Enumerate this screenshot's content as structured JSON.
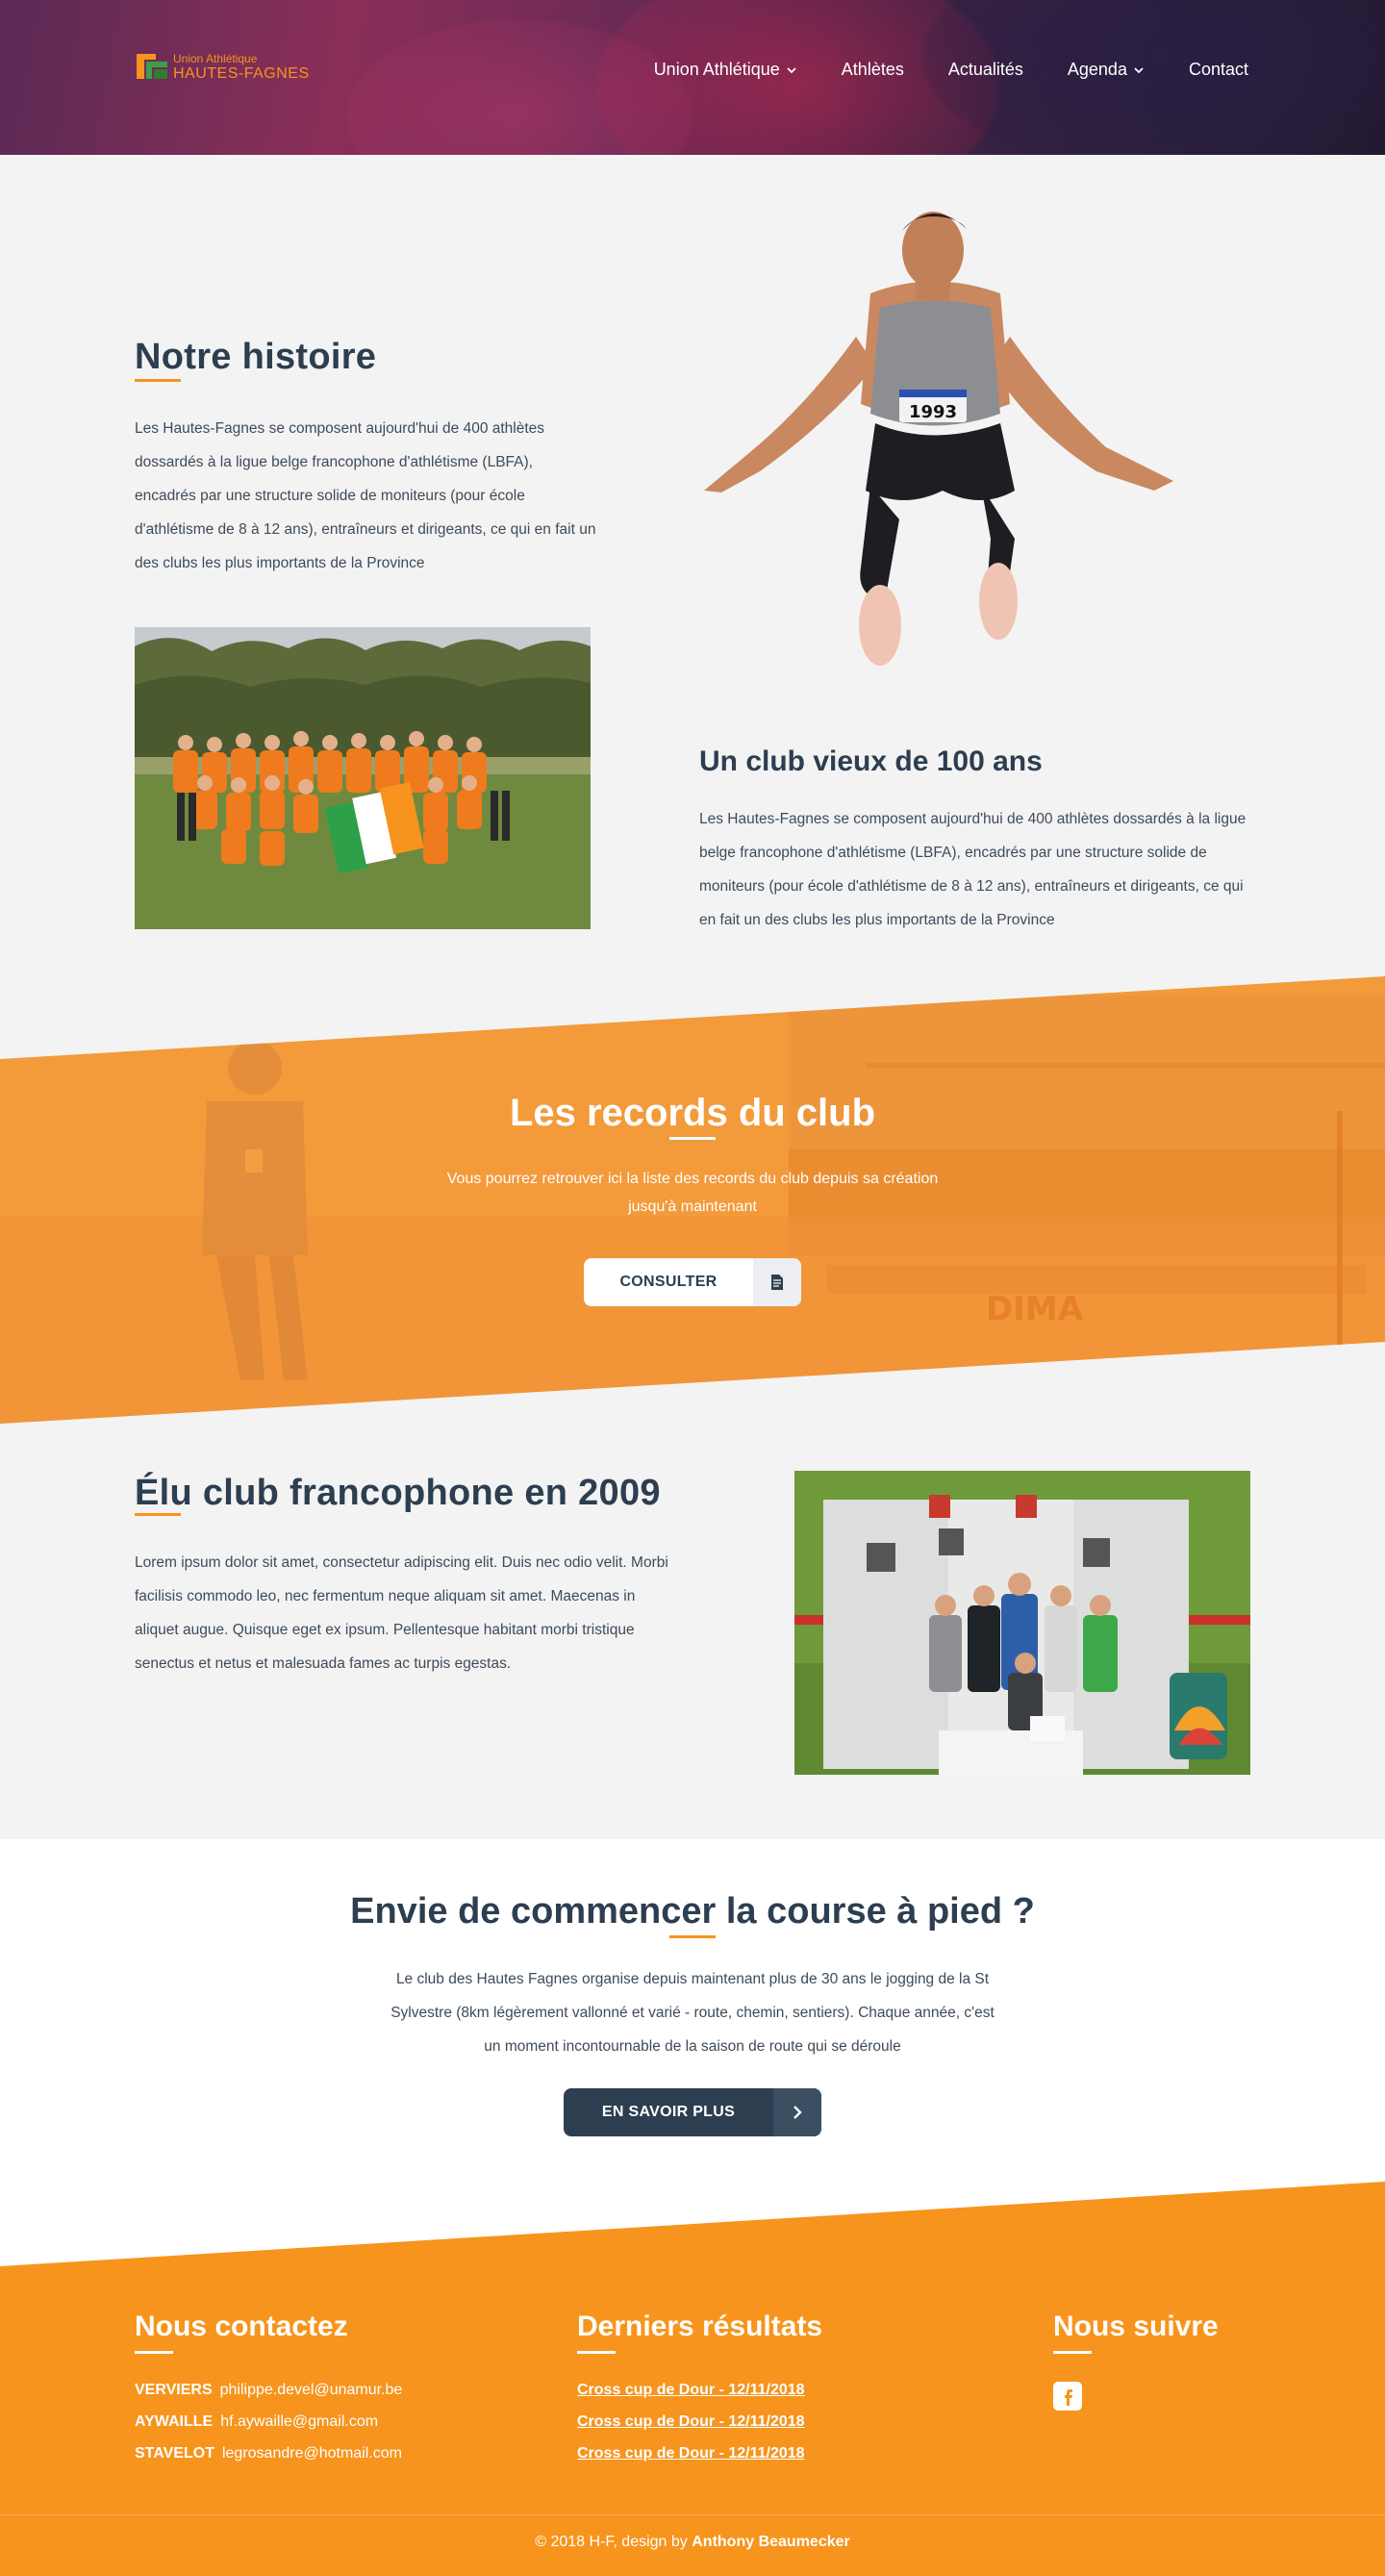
{
  "brand": {
    "logo_line1": "Union Athlétique",
    "logo_line2": "HAUTES-FAGNES",
    "accent": "#f7941d",
    "navy": "#2d3e50"
  },
  "nav": {
    "items": [
      {
        "label": "Union Athlétique",
        "dropdown": true
      },
      {
        "label": "Athlètes",
        "dropdown": false
      },
      {
        "label": "Actualités",
        "dropdown": false
      },
      {
        "label": "Agenda",
        "dropdown": true
      },
      {
        "label": "Contact",
        "dropdown": false
      }
    ]
  },
  "history": {
    "title": "Notre histoire",
    "text": "Les Hautes-Fagnes se composent aujourd'hui de 400 athlètes dossardés à la ligue belge francophone d'athlétisme (LBFA), encadrés par une structure solide de moniteurs (pour école d'athlétisme de 8 à 12 ans), entraîneurs et dirigeants, ce qui en fait un des clubs les plus importants de la Province",
    "athlete_bib": "1993"
  },
  "century": {
    "title": "Un club vieux de 100 ans",
    "text": "Les Hautes-Fagnes se composent aujourd'hui de 400 athlètes dossardés à la ligue belge francophone d'athlétisme (LBFA), encadrés par une structure solide de moniteurs (pour école d'athlétisme de 8 à 12 ans), entraîneurs et dirigeants, ce qui en fait un des clubs les plus importants de la Province"
  },
  "records": {
    "title": "Les records du club",
    "text": "Vous pourrez retrouver ici la liste des records du club depuis sa création jusqu'à maintenant",
    "button": "CONSULTER",
    "button_icon": "document-icon",
    "bg_sign": "DIMA"
  },
  "elected": {
    "title": "Élu club francophone en 2009",
    "text": "Lorem ipsum dolor sit amet, consectetur adipiscing elit. Duis nec odio velit. Morbi facilisis commodo leo, nec fermentum neque aliquam sit amet. Maecenas in aliquet augue. Quisque eget ex ipsum. Pellentesque habitant morbi tristique senectus et netus et malesuada fames ac turpis egestas."
  },
  "running": {
    "title": "Envie de commencer la course à pied ?",
    "text": "Le club des Hautes Fagnes organise depuis maintenant plus de 30 ans le jogging de la St Sylvestre (8km légèrement vallonné et varié - route, chemin, sentiers). Chaque année, c'est un moment incontournable de la saison de route qui se déroule",
    "button": "EN SAVOIR PLUS",
    "button_icon": "chevron-right-icon"
  },
  "footer": {
    "contact": {
      "title": "Nous contactez",
      "lines": [
        {
          "city": "VERVIERS",
          "email": "philippe.devel@unamur.be"
        },
        {
          "city": "AYWAILLE",
          "email": "hf.aywaille@gmail.com"
        },
        {
          "city": "STAVELOT",
          "email": "legrosandre@hotmail.com"
        }
      ]
    },
    "results": {
      "title": "Derniers résultats",
      "links": [
        "Cross cup de Dour - 12/11/2018",
        "Cross cup de Dour - 12/11/2018",
        "Cross cup de Dour - 12/11/2018"
      ]
    },
    "follow": {
      "title": "Nous suivre",
      "icon": "facebook-icon"
    },
    "copyright_prefix": "© 2018 H-F, design by",
    "copyright_author": "Anthony Beaumecker"
  }
}
